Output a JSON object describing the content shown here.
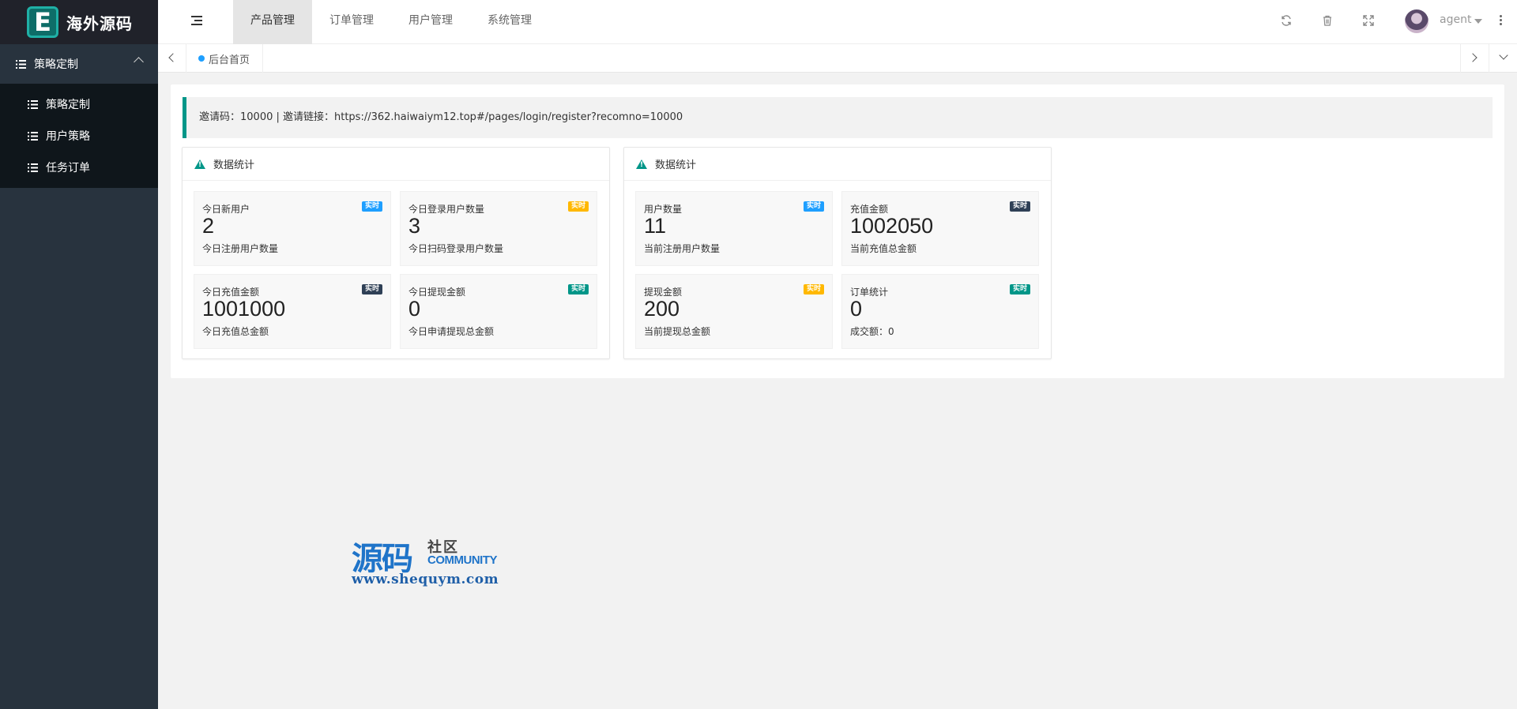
{
  "brand": {
    "logo_letter": "E",
    "name": "海外源码"
  },
  "sidebar": {
    "parent": {
      "label": "策略定制"
    },
    "items": [
      {
        "label": "策略定制"
      },
      {
        "label": "用户策略"
      },
      {
        "label": "任务订单"
      }
    ]
  },
  "header": {
    "tabs": [
      {
        "label": "产品管理",
        "active": true
      },
      {
        "label": "订单管理"
      },
      {
        "label": "用户管理"
      },
      {
        "label": "系统管理"
      }
    ],
    "icons": [
      "refresh-icon",
      "trash-icon",
      "fullscreen-icon"
    ],
    "user": "agent"
  },
  "tabbar": {
    "home": "后台首页"
  },
  "notice": {
    "text": "邀请码：10000 | 邀请链接：https://362.haiwaiym12.top#/pages/login/register?recomno=10000"
  },
  "panels": [
    {
      "title": "数据统计",
      "stats": [
        {
          "title": "今日新用户",
          "badge": "实时",
          "badge_color": "#1e9fff",
          "value": "2",
          "desc": "今日注册用户数量"
        },
        {
          "title": "今日登录用户数量",
          "badge": "实时",
          "badge_color": "#ffb800",
          "value": "3",
          "desc": "今日扫码登录用户数量"
        },
        {
          "title": "今日充值金额",
          "badge": "实时",
          "badge_color": "#2f4056",
          "value": "1001000",
          "desc": "今日充值总金额"
        },
        {
          "title": "今日提现金额",
          "badge": "实时",
          "badge_color": "#009688",
          "value": "0",
          "desc": "今日申请提现总金额"
        }
      ]
    },
    {
      "title": "数据统计",
      "stats": [
        {
          "title": "用户数量",
          "badge": "实时",
          "badge_color": "#1e9fff",
          "value": "11",
          "desc": "当前注册用户数量"
        },
        {
          "title": "充值金额",
          "badge": "实时",
          "badge_color": "#2f4056",
          "value": "1002050",
          "desc": "当前充值总金额"
        },
        {
          "title": "提现金额",
          "badge": "实时",
          "badge_color": "#ffb800",
          "value": "200",
          "desc": "当前提现总金额"
        },
        {
          "title": "订单统计",
          "badge": "实时",
          "badge_color": "#009688",
          "value": "0",
          "desc": "成交额：0"
        }
      ]
    }
  ],
  "watermark": {
    "big": "源码",
    "small": "社区",
    "en": "COMMUNITY",
    "url": "www.shequym.com"
  }
}
